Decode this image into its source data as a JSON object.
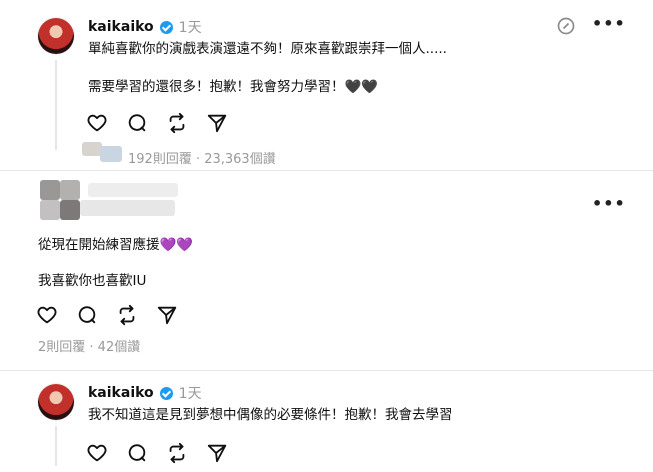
{
  "post1": {
    "username": "kaikaiko",
    "time": "1天",
    "line1": "單純喜歡你的演戲表演還遠不夠！原來喜歡跟崇拜一個人.....",
    "line2": "需要學習的還很多！抱歉！我會努力學習！🖤🖤",
    "meta": "192則回覆 · 23,363個讚"
  },
  "post2": {
    "line1": "從現在開始練習應援💜💜",
    "line2": "我喜歡你也喜歡IU",
    "meta": "2則回覆 · 42個讚"
  },
  "post3": {
    "username": "kaikaiko",
    "time": "1天",
    "line1": "我不知道這是見到夢想中偶像的必要條件！抱歉！我會去學習"
  },
  "icons": {
    "like": "heart-icon",
    "reply": "comment-icon",
    "repost": "repost-icon",
    "share": "send-icon",
    "more": "more-icon",
    "edit": "edit-icon"
  },
  "colors": {
    "verified": "#1d9bf0",
    "meta_text": "#999999",
    "divider": "#e8e8e8"
  }
}
